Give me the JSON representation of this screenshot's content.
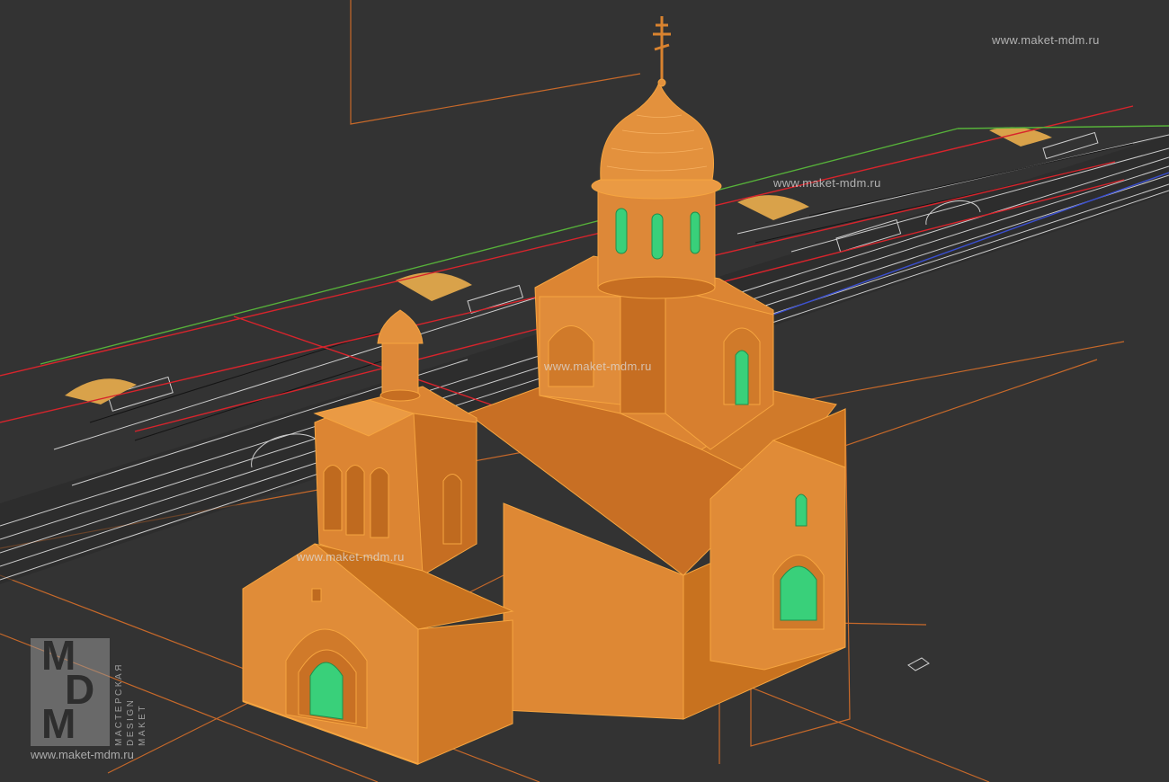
{
  "viewport": {
    "background": "#333333"
  },
  "colors": {
    "model_main": "#d9832f",
    "model_light": "#ea9a44",
    "model_dark": "#b8631c",
    "edge": "#f6a540",
    "glass": "#39d07a",
    "grid_line": "#c7692a",
    "axis_red": "#d8242c",
    "axis_green": "#57b23a",
    "blueprint": "#e8e8e8"
  },
  "watermarks": {
    "top_right": "www.maket-mdm.ru",
    "upper_mid": "www.maket-mdm.ru",
    "center": "www.maket-mdm.ru",
    "lower_left": "www.maket-mdm.ru"
  },
  "logo": {
    "letters": [
      "M",
      "D",
      "M"
    ],
    "vertical_lines": [
      "МАСТЕРСКАЯ",
      "DESIGN",
      "MAKET"
    ],
    "url": "www.maket-mdm.ru"
  }
}
